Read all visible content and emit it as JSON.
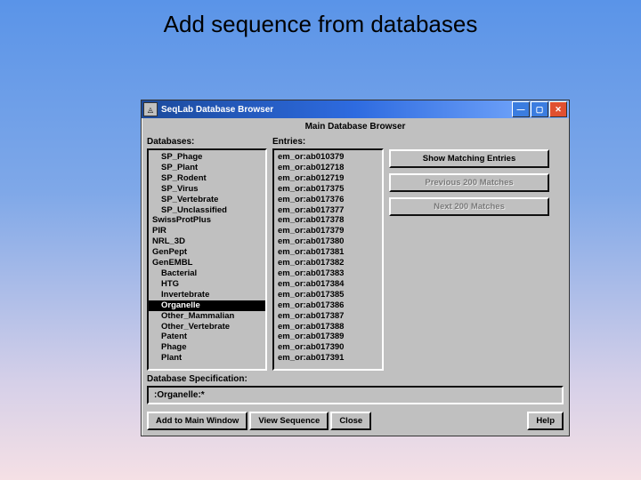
{
  "slide": {
    "title": "Add sequence from databases"
  },
  "window": {
    "title": "SeqLab Database Browser",
    "subtitle": "Main Database Browser",
    "col_databases_label": "Databases:",
    "col_entries_label": "Entries:",
    "databases": [
      {
        "label": "SP_Phage",
        "indent": 1,
        "selected": false
      },
      {
        "label": "SP_Plant",
        "indent": 1,
        "selected": false
      },
      {
        "label": "SP_Rodent",
        "indent": 1,
        "selected": false
      },
      {
        "label": "SP_Virus",
        "indent": 1,
        "selected": false
      },
      {
        "label": "SP_Vertebrate",
        "indent": 1,
        "selected": false
      },
      {
        "label": "SP_Unclassified",
        "indent": 1,
        "selected": false
      },
      {
        "label": "SwissProtPlus",
        "indent": 0,
        "selected": false
      },
      {
        "label": "PIR",
        "indent": 0,
        "selected": false
      },
      {
        "label": "NRL_3D",
        "indent": 0,
        "selected": false
      },
      {
        "label": "GenPept",
        "indent": 0,
        "selected": false
      },
      {
        "label": "GenEMBL",
        "indent": 0,
        "selected": false
      },
      {
        "label": "Bacterial",
        "indent": 1,
        "selected": false
      },
      {
        "label": "HTG",
        "indent": 1,
        "selected": false
      },
      {
        "label": "Invertebrate",
        "indent": 1,
        "selected": false
      },
      {
        "label": "Organelle",
        "indent": 1,
        "selected": true
      },
      {
        "label": "Other_Mammalian",
        "indent": 1,
        "selected": false
      },
      {
        "label": "Other_Vertebrate",
        "indent": 1,
        "selected": false
      },
      {
        "label": "Patent",
        "indent": 1,
        "selected": false
      },
      {
        "label": "Phage",
        "indent": 1,
        "selected": false
      },
      {
        "label": "Plant",
        "indent": 1,
        "selected": false
      }
    ],
    "entries": [
      "em_or:ab010379",
      "em_or:ab012718",
      "em_or:ab012719",
      "em_or:ab017375",
      "em_or:ab017376",
      "em_or:ab017377",
      "em_or:ab017378",
      "em_or:ab017379",
      "em_or:ab017380",
      "em_or:ab017381",
      "em_or:ab017382",
      "em_or:ab017383",
      "em_or:ab017384",
      "em_or:ab017385",
      "em_or:ab017386",
      "em_or:ab017387",
      "em_or:ab017388",
      "em_or:ab017389",
      "em_or:ab017390",
      "em_or:ab017391"
    ],
    "buttons": {
      "show_matching": "Show Matching Entries",
      "prev_200": "Previous 200 Matches",
      "next_200": "Next 200 Matches"
    },
    "spec_label": "Database Specification:",
    "spec_value": ":Organelle:*",
    "bottom": {
      "add_main": "Add to Main Window",
      "view_seq": "View Sequence",
      "close": "Close",
      "help": "Help"
    }
  }
}
